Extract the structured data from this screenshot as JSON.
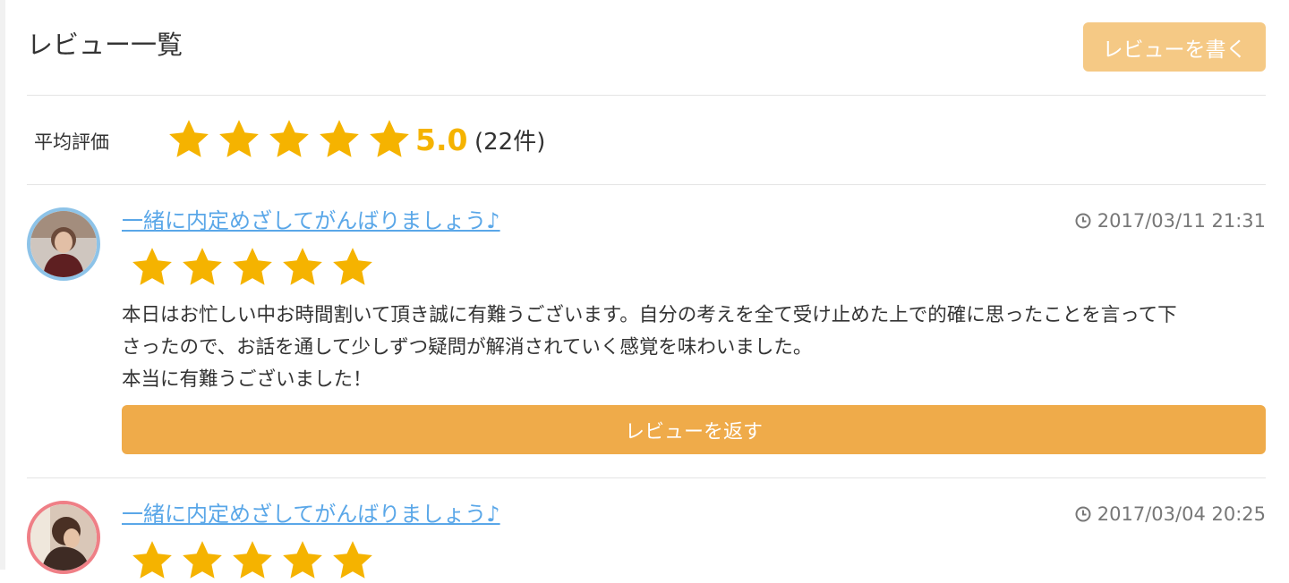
{
  "header": {
    "title": "レビュー一覧",
    "write_button_label": "レビューを書く"
  },
  "summary": {
    "label": "平均評価",
    "rating": 5,
    "rating_text": "5.0",
    "count_text": "(22件)",
    "star_icon": "star-icon",
    "star_color": "#f5b300"
  },
  "reviews": [
    {
      "title": "一緒に内定めざしてがんばりましょう♪",
      "date": "2017/03/11 21:31",
      "rating": 5,
      "body_lines": [
        "本日はお忙しい中お時間割いて頂き誠に有難うございます。自分の考えを全て受け止めた上で的確に思ったことを言って下",
        "さったので、お話を通して少しずつ疑問が解消されていく感覚を味わいました。",
        "本当に有難うございました！"
      ],
      "reply_button_label": "レビューを返す",
      "avatar_border_color": "#8dc3e8"
    },
    {
      "title": "一緒に内定めざしてがんばりましょう♪",
      "date": "2017/03/04 20:25",
      "rating": 5,
      "avatar_border_color": "#ef7f86"
    }
  ],
  "colors": {
    "accent": "#efab4a",
    "accent_light": "#f5c985",
    "link": "#5aa7e8"
  }
}
